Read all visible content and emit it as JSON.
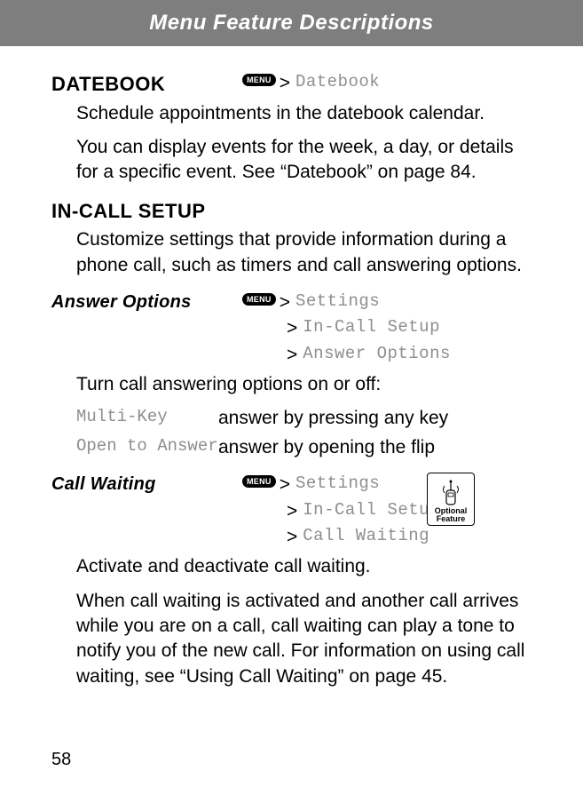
{
  "header": {
    "title": "Menu Feature Descriptions"
  },
  "menu_key_label": "MENU",
  "datebook": {
    "heading": "Datebook",
    "breadcrumb": [
      "Datebook"
    ],
    "p1": "Schedule appointments in the datebook calendar.",
    "p2": "You can display events for the week, a day, or details for a specific event. See “Datebook” on page 84."
  },
  "incall": {
    "heading": "In-Call Setup",
    "p1": "Customize settings that provide information during a phone call, such as timers and call answering options."
  },
  "answer": {
    "heading": "Answer Options",
    "breadcrumb": [
      "Settings",
      "In-Call Setup",
      "Answer Options"
    ],
    "intro": "Turn call answering options on or off:",
    "opts": [
      {
        "label": "Multi-Key",
        "desc": "answer by pressing any key"
      },
      {
        "label": "Open to Answer",
        "desc": "answer by opening the flip"
      }
    ]
  },
  "callwaiting": {
    "heading": "Call Waiting",
    "breadcrumb": [
      "Settings",
      "In-Call Setup",
      "Call Waiting"
    ],
    "badge_line1": "Optional",
    "badge_line2": "Feature",
    "p1": "Activate and deactivate call waiting.",
    "p2": "When call waiting is activated and another call arrives while you are on a call, call waiting can play a tone to notify you of the new call. For information on using call waiting, see “Using Call Waiting” on page 45."
  },
  "page_number": "58"
}
